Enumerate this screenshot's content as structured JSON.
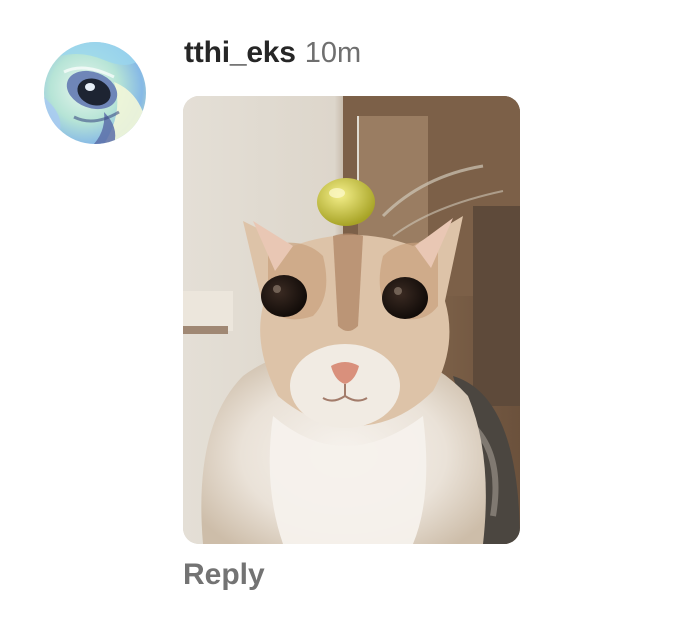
{
  "comment": {
    "username": "tthi_eks",
    "timestamp": "10m",
    "avatar_icon": "abstract-cat-eye-avatar",
    "media_icon": "cat-gif",
    "reply_label": "Reply"
  },
  "colors": {
    "username": "#262626",
    "timestamp": "#6f6f6f",
    "reply": "#737373",
    "background": "#ffffff"
  }
}
